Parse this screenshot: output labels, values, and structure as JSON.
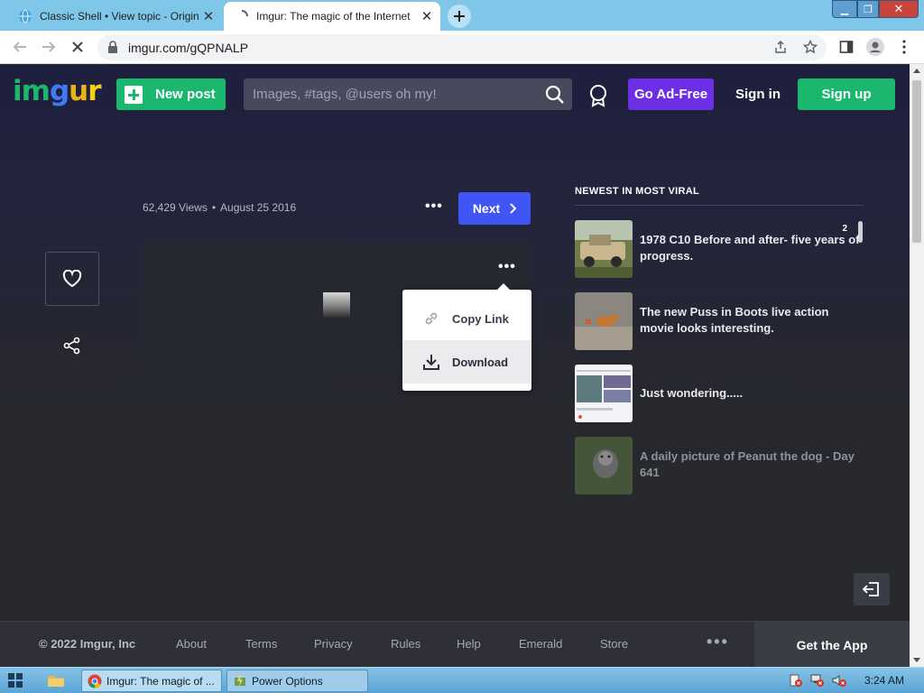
{
  "browser": {
    "tabs": [
      {
        "title": "Classic Shell • View topic - Origin",
        "close": "✕"
      },
      {
        "title": "Imgur: The magic of the Internet",
        "close": "✕"
      }
    ],
    "url": "imgur.com/gQPNALP",
    "window_controls": {
      "minimize": "▁",
      "maximize": "❐",
      "close": "✕"
    }
  },
  "header": {
    "logo_letters": [
      {
        "ch": "i",
        "color": "#1bb76e"
      },
      {
        "ch": "m",
        "color": "#1bb76e"
      },
      {
        "ch": "g",
        "color": "#3f7bf5"
      },
      {
        "ch": "u",
        "color": "#e8b21a"
      },
      {
        "ch": "r",
        "color": "#f5d113"
      }
    ],
    "new_post": "New post",
    "search_placeholder": "Images, #tags, @users oh my!",
    "ad_free": "Go Ad-Free",
    "sign_in": "Sign in",
    "sign_up": "Sign up"
  },
  "post": {
    "views": "62,429 Views",
    "dot": "•",
    "date": "August 25 2016",
    "more": "•••",
    "next": "Next"
  },
  "menu": {
    "copy_link": "Copy Link",
    "download": "Download"
  },
  "sidebar": {
    "heading": "NEWEST IN MOST VIRAL",
    "items": [
      {
        "title": "1978 C10 Before and after- five years of progress.",
        "count": "2"
      },
      {
        "title": "The new Puss in Boots live action movie looks interesting."
      },
      {
        "title": "Just wondering....."
      },
      {
        "title": "A daily picture of Peanut the dog - Day 641"
      }
    ]
  },
  "footer": {
    "copyright": "© 2022 Imgur, Inc",
    "links": [
      "About",
      "Terms",
      "Privacy",
      "Rules",
      "Help",
      "Emerald",
      "Store"
    ],
    "more": "•••",
    "get_app": "Get the App"
  },
  "taskbar": {
    "tasks": [
      "Imgur: The magic of ...",
      "Power Options"
    ],
    "clock": "3:24 AM"
  },
  "colors": {
    "accent_green": "#1bb76e",
    "ad_free_purple": "#6c2fe6",
    "next_blue": "#3f56f5"
  }
}
